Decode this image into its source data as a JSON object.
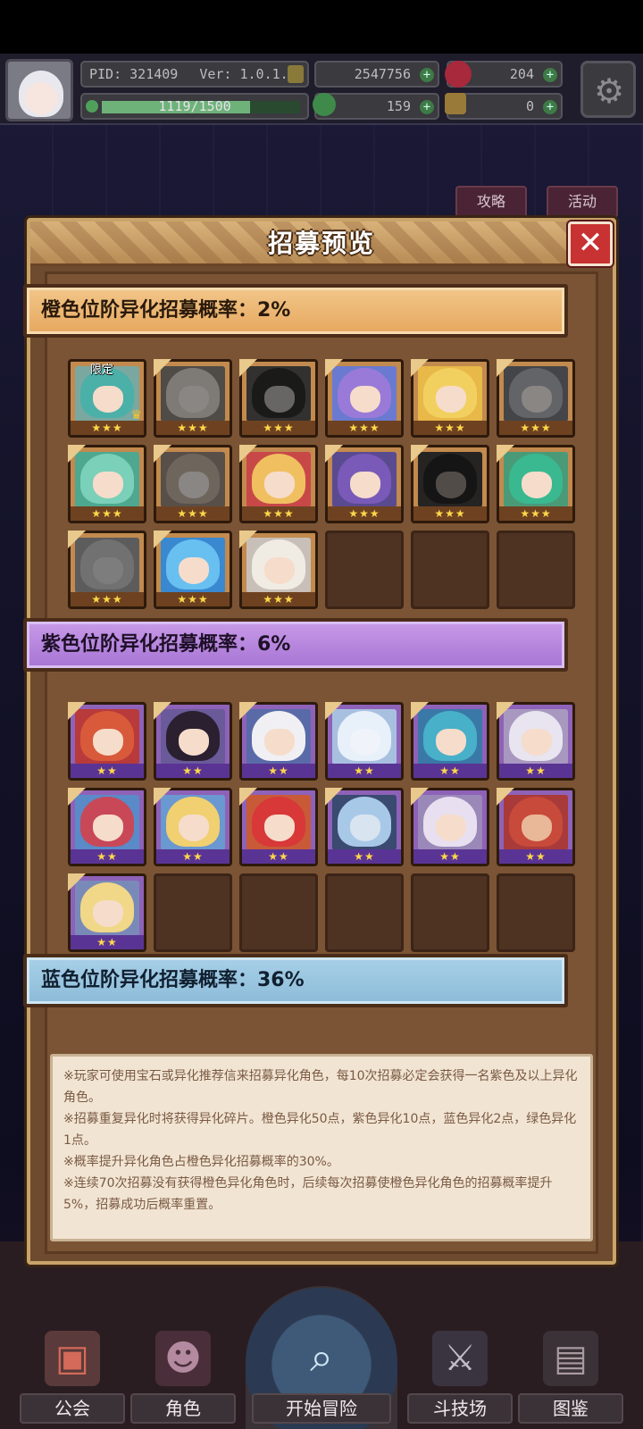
{
  "hud": {
    "pid": "PID: 321409",
    "version": "Ver: 1.0.1.2",
    "exp_text": "1119/1500",
    "exp_progress": 0.746,
    "gold": "2547756",
    "ruby": "204",
    "clover": "159",
    "key": "0",
    "plus": "+"
  },
  "background_hints": {
    "strategy": "攻略",
    "event": "活动"
  },
  "modal": {
    "title": "招募预览",
    "close": "✕",
    "orange_rate": "橙色位阶异化招募概率：2%",
    "purple_rate": "紫色位阶异化招募概率：6%",
    "blue_rate": "蓝色位阶异化招募概率：36%",
    "limited_label": "限定",
    "three_stars": "★★★",
    "two_stars": "★★",
    "notes": [
      "※玩家可使用宝石或异化推荐信来招募异化角色，每10次招募必定会获得一名紫色及以上异化角色。",
      "※招募重复异化时将获得异化碎片。橙色异化50点，紫色异化10点，蓝色异化2点，绿色异化1点。",
      "※概率提升异化角色占橙色异化招募概率的30%。",
      "※连续70次招募没有获得橙色异化角色时，后续每次招募使橙色异化角色的招募概率提升5%，招募成功后概率重置。"
    ]
  },
  "bottom_nav": {
    "guild": "公会",
    "character": "角色",
    "adventure": "开始冒险",
    "arena": "斗技场",
    "codex": "图鉴"
  },
  "colors": {
    "orange_tier": "#e6a75e",
    "purple_tier": "#a674d4",
    "blue_tier": "#8cbbd8",
    "close_red": "#c83232",
    "modal_brown": "#6e4a2e"
  }
}
